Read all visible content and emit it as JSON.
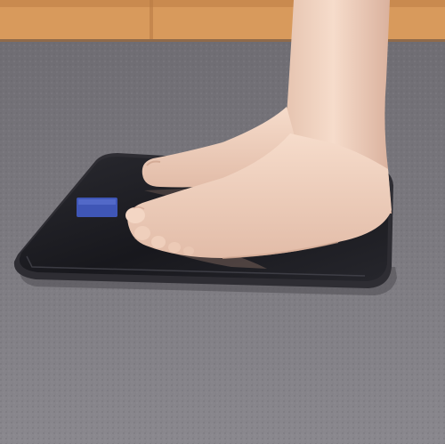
{
  "image": {
    "objects": [
      "wall-baseboard",
      "carpet-floor",
      "bathroom-scale",
      "scale-display",
      "left-foot",
      "right-foot",
      "leg"
    ],
    "colors": {
      "wall": "#d89a5c",
      "carpet": "#7f7d83",
      "scale_surface": "#1c1c22",
      "scale_edge": "#2e2d33",
      "display": "#3f56b6",
      "skin": "#f1d3c0",
      "skin_shadow": "#d9b19f"
    }
  }
}
